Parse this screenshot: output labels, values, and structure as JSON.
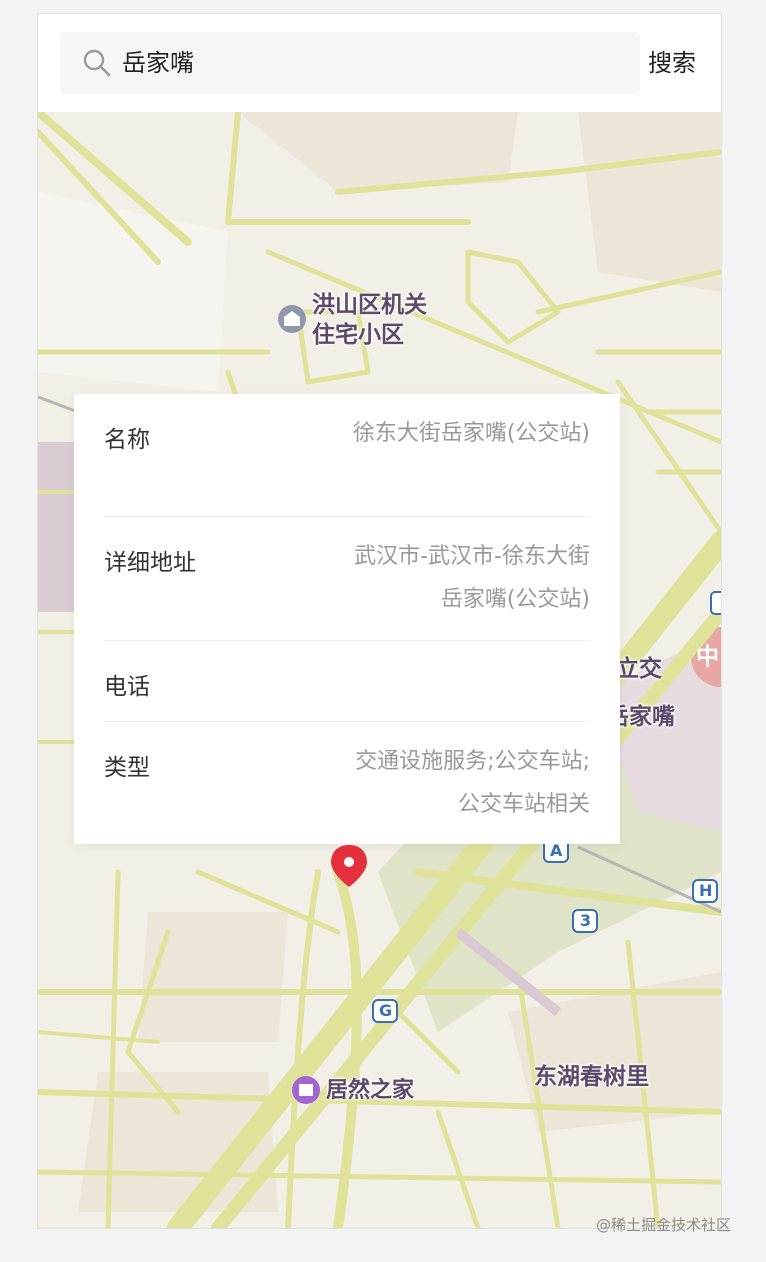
{
  "search": {
    "query": "岳家嘴",
    "button_label": "搜索"
  },
  "map": {
    "labels": {
      "hongshan": [
        "洪山区机关",
        "住宅小区"
      ],
      "donghu": "东湖春树里",
      "jurans": "居然之家",
      "station_partial_1": "立交",
      "station_partial_2": "岳家嘴",
      "metro_badge": "中"
    },
    "markers": {
      "road_a": "A",
      "road_3": "3",
      "road_g": "G",
      "road_h": "H"
    }
  },
  "info": {
    "rows": [
      {
        "key": "名称",
        "value": "徐东大街岳家嘴(公交站)"
      },
      {
        "key": "详细地址",
        "value": "武汉市-武汉市-徐东大街岳家嘴(公交站)"
      },
      {
        "key": "电话",
        "value": ""
      },
      {
        "key": "类型",
        "value": "交通设施服务;公交车站;公交车站相关"
      }
    ]
  },
  "watermark": "@稀土掘金技术社区",
  "colors": {
    "road": "#dfe39a",
    "land": "#f2efe6",
    "marker": "#e5313e",
    "poi_purple": "#a364d6"
  }
}
